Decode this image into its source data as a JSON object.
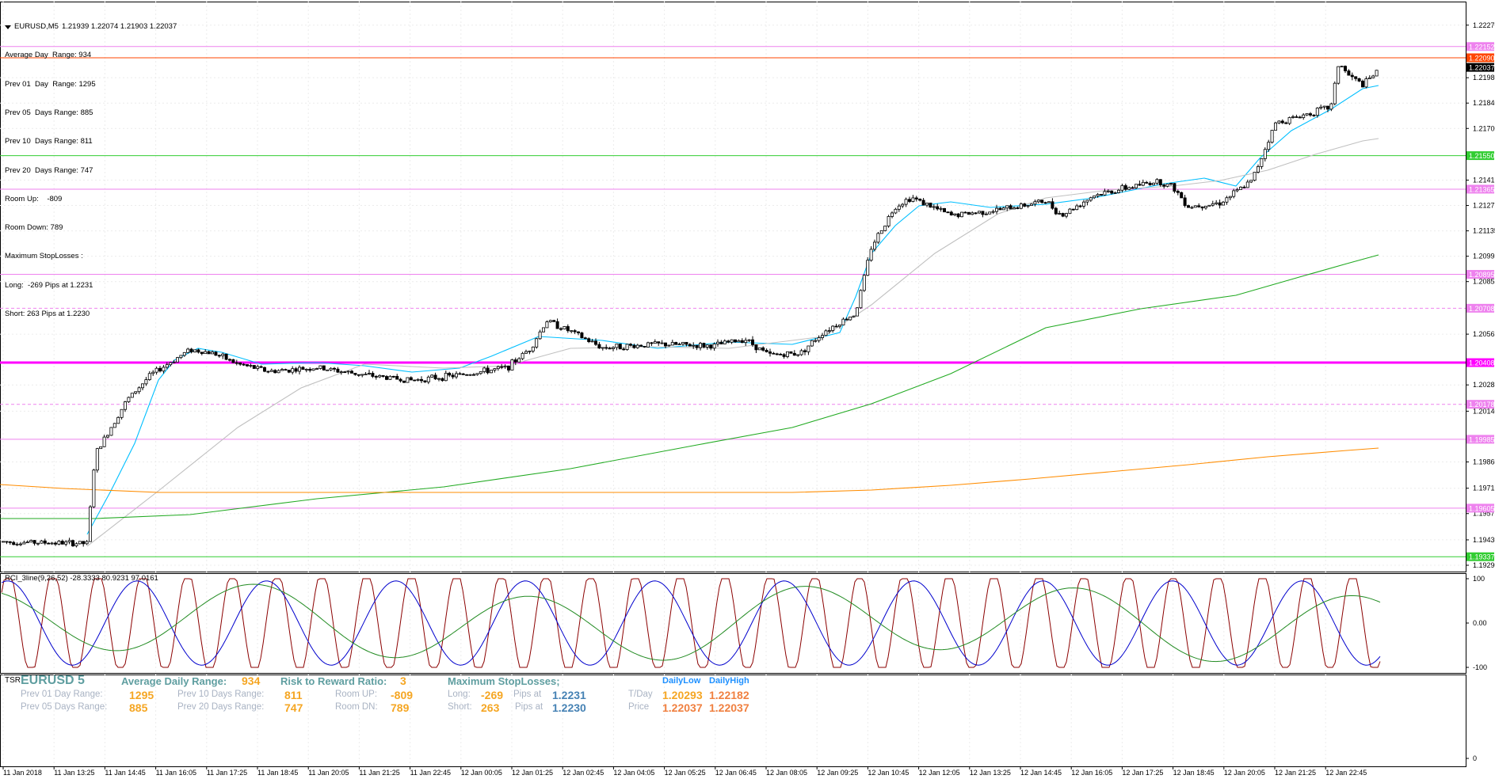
{
  "window": {
    "symbol_timeframe": "EURUSD,M5",
    "ohlc": "1.21939 1.22074 1.21903 1.22037"
  },
  "info_lines": [
    "Average Day  Range: 934",
    "Prev 01  Day  Range: 1295",
    "Prev 05  Days Range: 885",
    "Prev 10  Days Range: 811",
    "Prev 20  Days Range: 747",
    "Room Up:    -809",
    "Room Down: 789",
    "Maximum StopLosses :",
    "Long:  -269 Pips at 1.2231",
    "Short: 263 Pips at 1.2230"
  ],
  "price_axis": {
    "ticks": [
      "1.22270",
      "1.21980",
      "1.21840",
      "1.21700",
      "1.21415",
      "1.21275",
      "1.21135",
      "1.20995",
      "1.20855",
      "1.20565",
      "1.20285",
      "1.20140",
      "1.19860",
      "1.19715",
      "1.19575",
      "1.19430",
      "1.19290"
    ],
    "badges": [
      {
        "price": 1.22152,
        "text": "1.22152",
        "color": "#ee82ee",
        "text_color": "#ffffff"
      },
      {
        "price": 1.2209,
        "text": "1.22090",
        "color": "#ff4500",
        "text_color": "#ffffff"
      },
      {
        "price": 1.22037,
        "text": "1.22037",
        "color": "#000000",
        "text_color": "#ffffff"
      },
      {
        "price": 1.2155,
        "text": "1.21550",
        "color": "#32cd32",
        "text_color": "#ffffff"
      },
      {
        "price": 1.21365,
        "text": "1.21365",
        "color": "#ee82ee",
        "text_color": "#ffffff"
      },
      {
        "price": 1.20895,
        "text": "1.20895",
        "color": "#ee82ee",
        "text_color": "#ffffff"
      },
      {
        "price": 1.20708,
        "text": "1.20708",
        "color": "#ee82ee",
        "text_color": "#ffffff"
      },
      {
        "price": 1.20408,
        "text": "1.20408",
        "color": "#ff00ff",
        "text_color": "#ffffff"
      },
      {
        "price": 1.20178,
        "text": "1.20178",
        "color": "#ee82ee",
        "text_color": "#ffffff"
      },
      {
        "price": 1.19985,
        "text": "1.19985",
        "color": "#ee82ee",
        "text_color": "#ffffff"
      },
      {
        "price": 1.19605,
        "text": "1.19605",
        "color": "#ee82ee",
        "text_color": "#ffffff"
      },
      {
        "price": 1.19337,
        "text": "1.19337",
        "color": "#32cd32",
        "text_color": "#ffffff"
      }
    ]
  },
  "levels": [
    {
      "price": 1.22152,
      "color": "#ee82ee",
      "style": "solid"
    },
    {
      "price": 1.2209,
      "color": "#ff4500",
      "style": "solid"
    },
    {
      "price": 1.2155,
      "color": "#32cd32",
      "style": "solid"
    },
    {
      "price": 1.21365,
      "color": "#ee82ee",
      "style": "solid"
    },
    {
      "price": 1.20895,
      "color": "#ee82ee",
      "style": "solid"
    },
    {
      "price": 1.20708,
      "color": "#ee82ee",
      "style": "dashed"
    },
    {
      "price": 1.20408,
      "color": "#ff00ff",
      "style": "thick"
    },
    {
      "price": 1.20178,
      "color": "#ee82ee",
      "style": "dashed"
    },
    {
      "price": 1.19985,
      "color": "#ee82ee",
      "style": "solid"
    },
    {
      "price": 1.19605,
      "color": "#ee82ee",
      "style": "solid"
    },
    {
      "price": 1.19337,
      "color": "#32cd32",
      "style": "solid"
    }
  ],
  "time_axis": [
    "11 Jan 2018",
    "11 Jan 13:25",
    "11 Jan 14:45",
    "11 Jan 16:05",
    "11 Jan 17:25",
    "11 Jan 18:45",
    "11 Jan 20:05",
    "11 Jan 21:25",
    "11 Jan 22:45",
    "12 Jan 00:05",
    "12 Jan 01:25",
    "12 Jan 02:45",
    "12 Jan 04:05",
    "12 Jan 05:25",
    "12 Jan 06:45",
    "12 Jan 08:05",
    "12 Jan 09:25",
    "12 Jan 10:45",
    "12 Jan 12:05",
    "12 Jan 13:25",
    "12 Jan 14:45",
    "12 Jan 16:05",
    "12 Jan 17:25",
    "12 Jan 18:45",
    "12 Jan 20:05",
    "12 Jan 21:25",
    "12 Jan 22:45"
  ],
  "rci": {
    "label": "RCI_3line(9,26,52) -28.3333 80.9231 97.0161",
    "ticks": [
      "100",
      "0.00",
      "-100"
    ]
  },
  "tsr_axis": {
    "ticks": [
      "0"
    ]
  },
  "tsr": {
    "tag": "TSR",
    "symbol": "EURUSD 5",
    "avg_daily_range_label": "Average Daily Range:",
    "avg_daily_range_value": "934",
    "rr_label": "Risk to Reward Ratio:",
    "rr_value": "3",
    "max_sl_label": "Maximum  StopLosses;",
    "prev01_label": "Prev 01 Day Range:",
    "prev01_value": "1295",
    "prev05_label": "Prev 05 Days Range:",
    "prev05_value": "885",
    "prev10_label": "Prev 10 Days Range:",
    "prev10_value": "811",
    "prev20_label": "Prev 20 Days Range:",
    "prev20_value": "747",
    "room_up_label": "Room UP:",
    "room_up_value": "-809",
    "room_dn_label": "Room DN:",
    "room_dn_value": "789",
    "long_label": "Long:",
    "long_value": "-269",
    "short_label": "Short:",
    "short_value": "263",
    "pips_at_label_1": "Pips at",
    "pips_at_value_1": "1.2231",
    "pips_at_label_2": "Pips at",
    "pips_at_value_2": "1.2230",
    "daily_low_header": "DailyLow",
    "daily_high_header": "DailyHigh",
    "tday_label": "T/Day",
    "tday_low": "1.20293",
    "tday_high": "1.22182",
    "price_label": "Price",
    "price_low": "1.22037",
    "price_high": "1.22037"
  },
  "colors": {
    "ma_fast": "#00bfff",
    "ma_mid": "#c0c0c0",
    "ma_slow": "#22aa22",
    "ma_slowest": "#ff8c00",
    "rci_short": "#8b0000",
    "rci_mid": "#0000cd",
    "rci_long": "#228b22"
  }
}
